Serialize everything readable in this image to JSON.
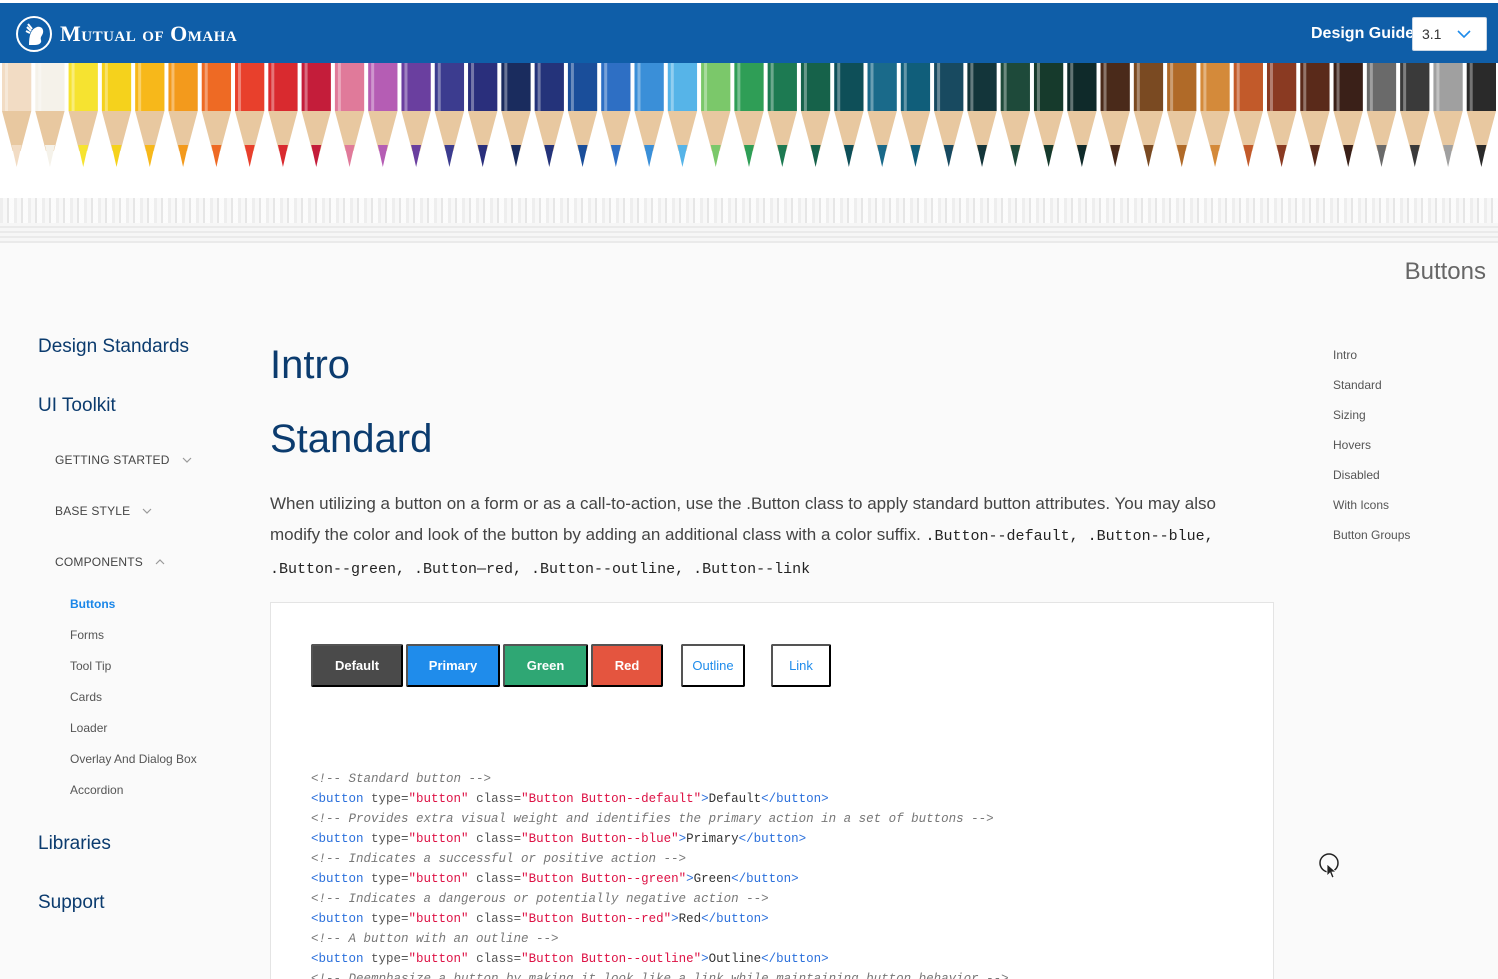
{
  "header": {
    "logo_text": "Mutual of Omaha",
    "guide_label": "Design Guide",
    "version": "3.1",
    "brand_color": "#0f5ea8"
  },
  "page_label": "Buttons",
  "leftnav": {
    "design_standards": "Design Standards",
    "ui_toolkit": "UI Toolkit",
    "getting_started": "GETTING STARTED",
    "base_style": "BASE STYLE",
    "components": "COMPONENTS",
    "items": [
      "Buttons",
      "Forms",
      "Tool Tip",
      "Cards",
      "Loader",
      "Overlay And Dialog Box",
      "Accordion"
    ],
    "libraries": "Libraries",
    "support": "Support"
  },
  "main": {
    "intro_title": "Intro",
    "standard_title": "Standard",
    "desc_text_1": "When utilizing a button on a form or as a call-to-action, use the .Button class to apply standard button attributes. You may also modify the color and look of the button by adding an additional class with a color suffix.",
    "desc_code_1": ".Button--default, .Button--blue,",
    "desc_code_2": ".Button--green, .Button—red, .Button--outline, .Button--link"
  },
  "demo_buttons": {
    "default": "Default",
    "primary": "Primary",
    "green": "Green",
    "red": "Red",
    "outline": "Outline",
    "link": "Link",
    "colors": {
      "default": "#4a4a4a",
      "primary": "#1f8ceb",
      "green": "#2fa774",
      "red": "#e4553f"
    }
  },
  "code_lines": [
    {
      "type": "comment",
      "text": "<!-- Standard button -->"
    },
    {
      "type": "button",
      "cls": "Button Button--default",
      "label": "Default"
    },
    {
      "type": "comment",
      "text": "<!-- Provides extra visual weight and identifies the primary action in a set of buttons -->"
    },
    {
      "type": "button",
      "cls": "Button Button--blue",
      "label": "Primary"
    },
    {
      "type": "comment",
      "text": "<!-- Indicates a successful or positive action -->"
    },
    {
      "type": "button",
      "cls": "Button Button--green",
      "label": "Green"
    },
    {
      "type": "comment",
      "text": "<!-- Indicates a dangerous or potentially negative action -->"
    },
    {
      "type": "button",
      "cls": "Button Button--red",
      "label": "Red"
    },
    {
      "type": "comment",
      "text": "<!-- A button with an outline -->"
    },
    {
      "type": "button",
      "cls": "Button Button--outline",
      "label": "Outline"
    },
    {
      "type": "comment",
      "text": "<!-- Deemphasize a button by making it look like a link while maintaining button behavior -->"
    }
  ],
  "rightnav": [
    "Intro",
    "Standard",
    "Sizing",
    "Hovers",
    "Disabled",
    "With Icons",
    "Button Groups"
  ],
  "pencil_colors": [
    "#f2dcc4",
    "#f5f2ea",
    "#f6e330",
    "#f5d21c",
    "#f7b81a",
    "#f39a1c",
    "#ee6a24",
    "#e8402c",
    "#d92a2f",
    "#c41d3a",
    "#e07a9a",
    "#b55db4",
    "#6a3f9f",
    "#3c3c8f",
    "#2a2f7c",
    "#1a2c5e",
    "#24337a",
    "#1a4e9a",
    "#2e6fc4",
    "#3a8fd8",
    "#56b4e8",
    "#7bc86a",
    "#2f9e56",
    "#1d7a52",
    "#16624a",
    "#0e4f58",
    "#1a6a8a",
    "#105e7a",
    "#184a60",
    "#13353a",
    "#1e4a3a",
    "#163a2c",
    "#0f2a2a",
    "#4a2a1a",
    "#7a4a22",
    "#b06a28",
    "#d48a3a",
    "#c25a2a",
    "#8a3a22",
    "#5a2a1a",
    "#3a2018",
    "#6a6a6a",
    "#3a3a3a",
    "#a0a0a0",
    "#2a2a2a"
  ]
}
